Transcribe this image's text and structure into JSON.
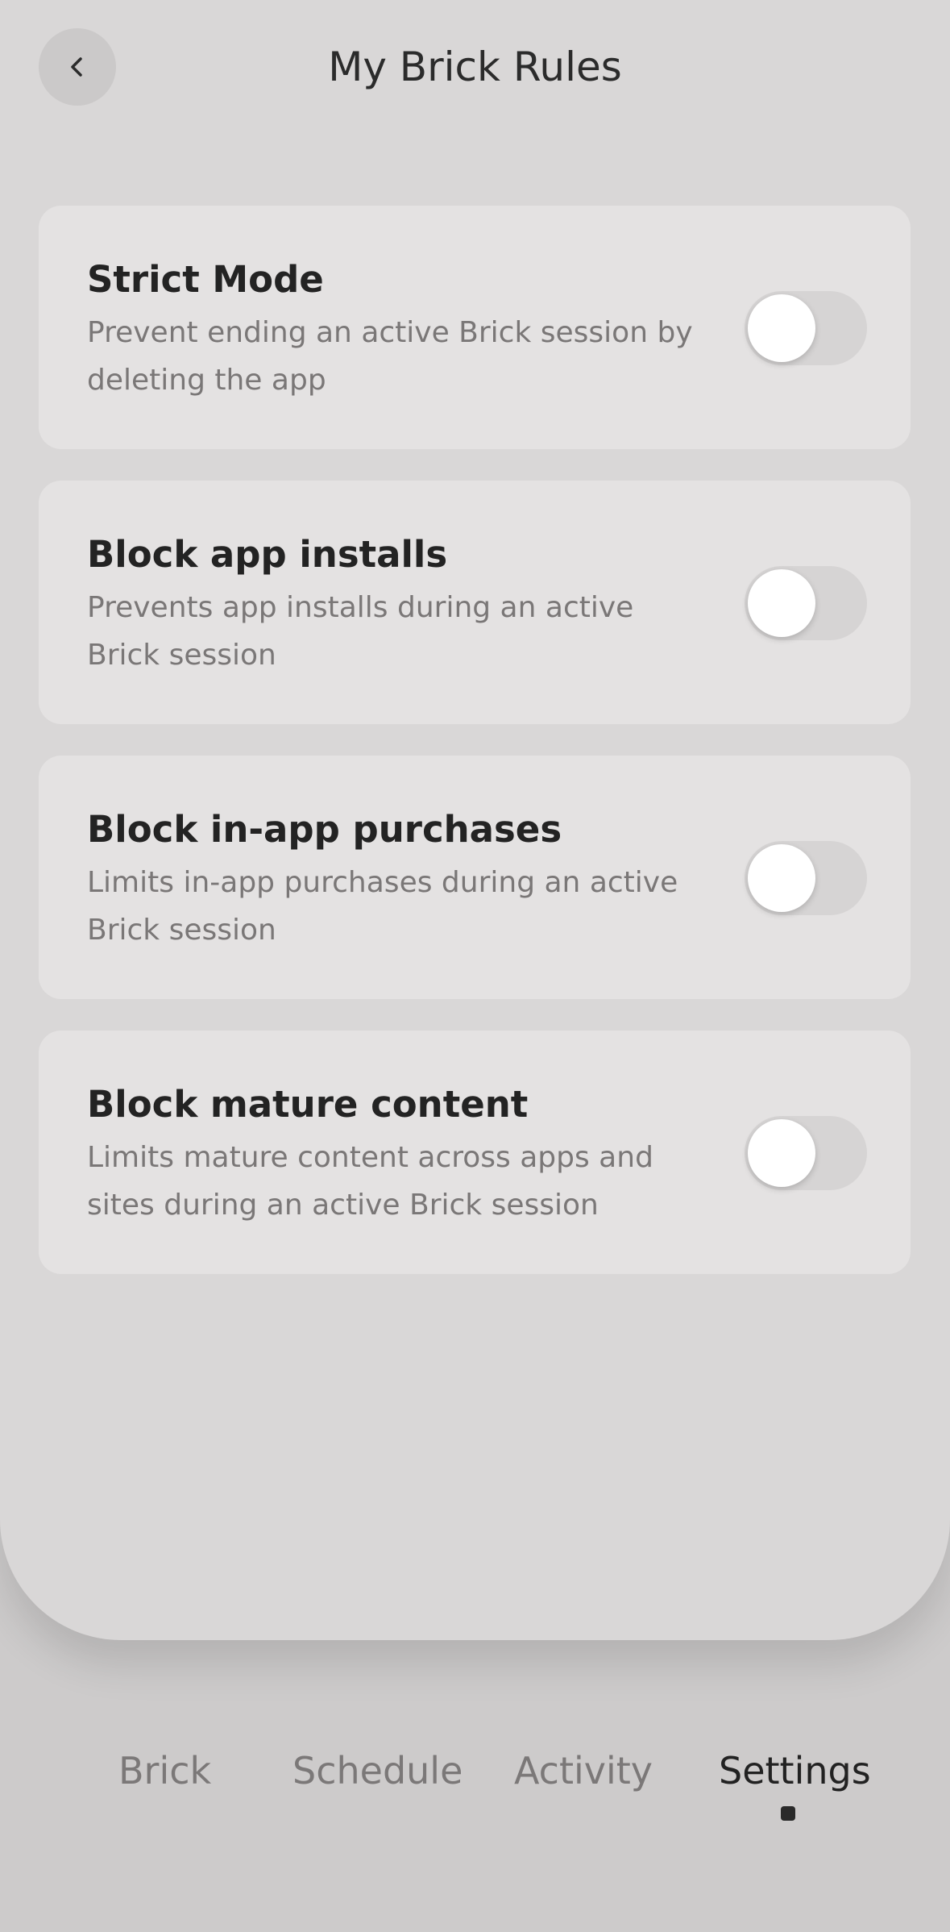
{
  "header": {
    "title": "My Brick Rules",
    "back_icon": "chevron-left-icon"
  },
  "rules": [
    {
      "title": "Strict Mode",
      "description": "Prevent ending an active Brick session by deleting the app",
      "enabled": false
    },
    {
      "title": "Block app installs",
      "description": "Prevents app installs during an active Brick session",
      "enabled": false
    },
    {
      "title": "Block in-app purchases",
      "description": "Limits in-app purchases during an active Brick session",
      "enabled": false
    },
    {
      "title": "Block mature content",
      "description": "Limits mature content across apps and sites during an active Brick session",
      "enabled": false
    }
  ],
  "tabs": [
    {
      "label": "Brick",
      "active": false
    },
    {
      "label": "Schedule",
      "active": false
    },
    {
      "label": "Activity",
      "active": false
    },
    {
      "label": "Settings",
      "active": true
    }
  ],
  "colors": {
    "background": "#d9d7d7",
    "card": "#e4e2e2",
    "toggle_off": "#d6d4d4",
    "active_tab": "#222222"
  }
}
